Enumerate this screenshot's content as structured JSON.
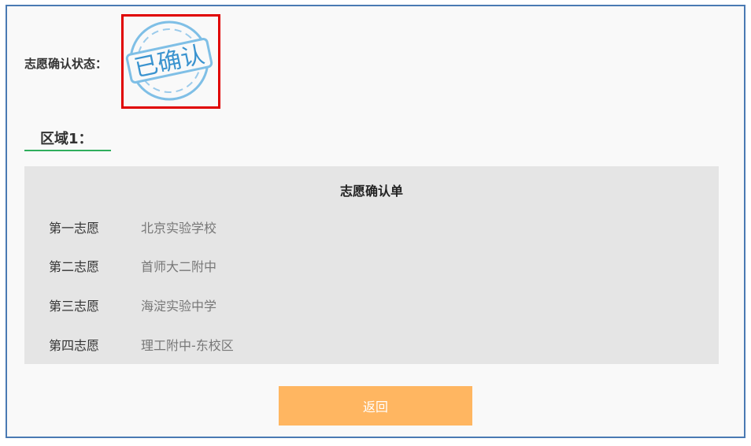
{
  "status": {
    "label": "志愿确认状态：",
    "stamp_text": "已确认",
    "stamp_color": "#3a93cf",
    "highlight_color": "#e00000"
  },
  "region": {
    "tab_label": "区域1：",
    "underline_color": "#2fae5c"
  },
  "confirmation_form": {
    "title": "志愿确认单",
    "choices": [
      {
        "label": "第一志愿",
        "school": "北京实验学校"
      },
      {
        "label": "第二志愿",
        "school": "首师大二附中"
      },
      {
        "label": "第三志愿",
        "school": "海淀实验中学"
      },
      {
        "label": "第四志愿",
        "school": "理工附中-东校区"
      }
    ]
  },
  "actions": {
    "back_label": "返回",
    "back_color": "#ffb661"
  }
}
